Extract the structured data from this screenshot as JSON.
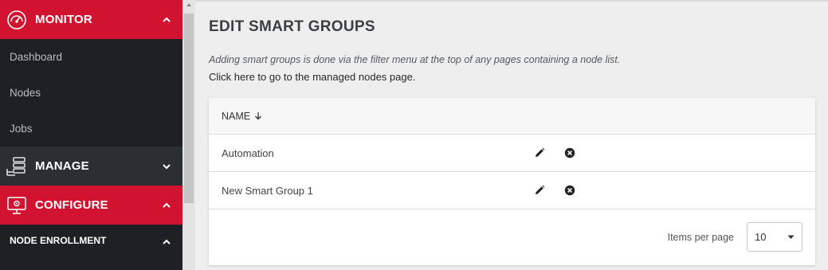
{
  "sidebar": {
    "monitor": {
      "label": "MONITOR",
      "icon": "gauge-icon",
      "expanded": true
    },
    "monitor_items": [
      {
        "label": "Dashboard"
      },
      {
        "label": "Nodes"
      },
      {
        "label": "Jobs"
      }
    ],
    "manage": {
      "label": "MANAGE",
      "icon": "server-stack-icon",
      "expanded": false
    },
    "configure": {
      "label": "CONFIGURE",
      "icon": "monitor-gear-icon",
      "expanded": true
    },
    "configure_items": [
      {
        "label": "NODE ENROLLMENT",
        "expanded": true
      }
    ]
  },
  "main": {
    "title": "EDIT SMART GROUPS",
    "hint": "Adding smart groups is done via the filter menu at the top of any pages containing a node list.",
    "link_text": "Click here to go to the managed nodes page.",
    "table": {
      "column_name": "NAME",
      "sort_direction": "descending",
      "rows": [
        {
          "name": "Automation"
        },
        {
          "name": "New Smart Group 1"
        }
      ]
    },
    "pagination": {
      "items_per_page_label": "Items per page",
      "items_per_page_value": "10"
    }
  },
  "colors": {
    "brand_red": "#d2132f",
    "sidebar_bg": "#1e2023",
    "manage_bg": "#2b2f33"
  }
}
